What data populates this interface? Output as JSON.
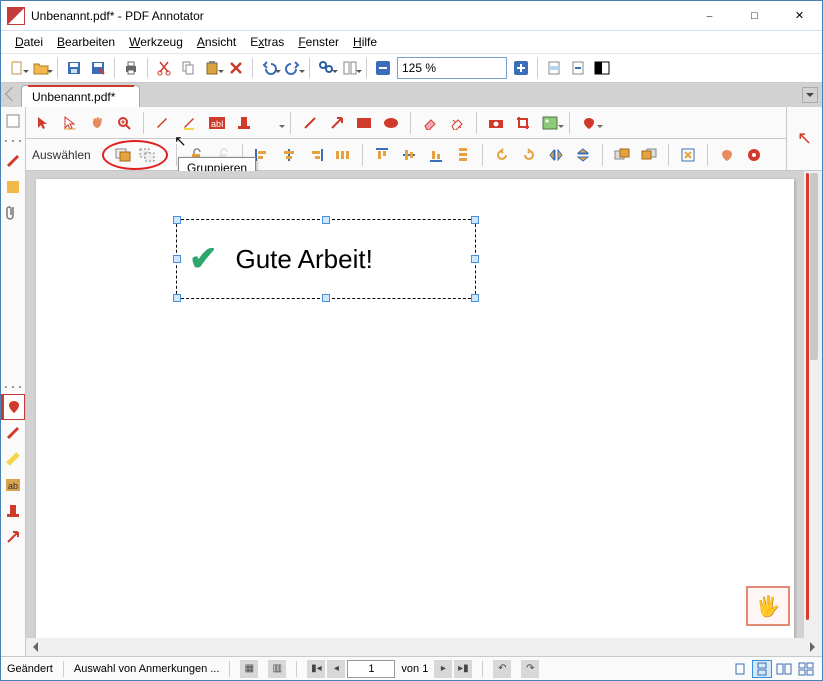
{
  "titlebar": {
    "title": "Unbenannt.pdf* - PDF Annotator"
  },
  "menu": {
    "datei": "Datei",
    "bearbeiten": "Bearbeiten",
    "werkzeug": "Werkzeug",
    "ansicht": "Ansicht",
    "extras": "Extras",
    "fenster": "Fenster",
    "hilfe": "Hilfe"
  },
  "toolbar": {
    "zoom": "125 %"
  },
  "tab": {
    "name": "Unbenannt.pdf*"
  },
  "annobar": {
    "select_label": "Auswählen",
    "tooltip": "Gruppieren"
  },
  "selection": {
    "text": "Gute Arbeit!"
  },
  "status": {
    "modified": "Geändert",
    "selection_msg": "Auswahl von Anmerkungen ...",
    "page_input": "1",
    "page_of": "von 1"
  }
}
